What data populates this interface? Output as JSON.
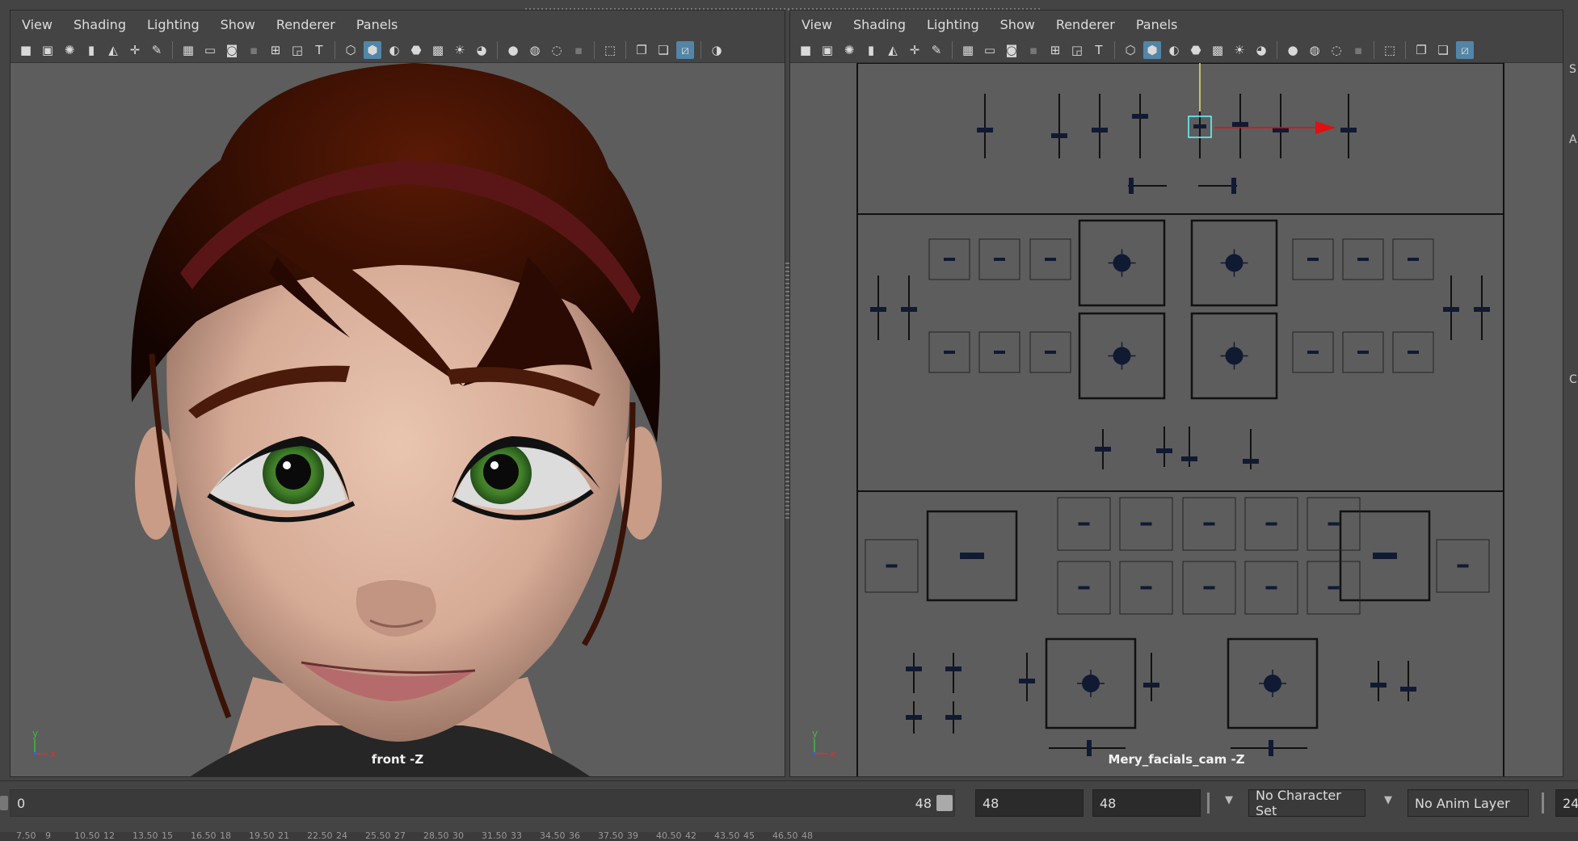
{
  "left_panel": {
    "menu": [
      "View",
      "Shading",
      "Lighting",
      "Show",
      "Renderer",
      "Panels"
    ],
    "camera": "front -Z",
    "axis_y": "y",
    "axis_x": "x"
  },
  "right_panel": {
    "menu": [
      "View",
      "Shading",
      "Lighting",
      "Show",
      "Renderer",
      "Panels"
    ],
    "camera": "Mery_facials_cam -Z",
    "axis_y": "y",
    "axis_x": "x"
  },
  "timeline": {
    "range_start": "0",
    "range_end": "48",
    "start_field": "48",
    "end_field": "48",
    "character_set": "No Character Set",
    "anim_layer": "No Anim Layer",
    "fps_partial": "24",
    "ticks": [
      "7.50",
      "9",
      "10.50",
      "12",
      "13.50",
      "15",
      "16.50",
      "18",
      "19.50",
      "21",
      "22.50",
      "24",
      "25.50",
      "27",
      "28.50",
      "30",
      "31.50",
      "33",
      "34.50",
      "36",
      "37.50",
      "39",
      "40.50",
      "42",
      "43.50",
      "45",
      "46.50",
      "48"
    ]
  },
  "right_edge_labels": [
    "S",
    "A",
    "C"
  ],
  "colors": {
    "panel_bg": "#5d5d5d",
    "ui_bg": "#444444",
    "active_icon": "#5285a6",
    "controller": "#111a33",
    "manip_arrow": "#e01010"
  }
}
